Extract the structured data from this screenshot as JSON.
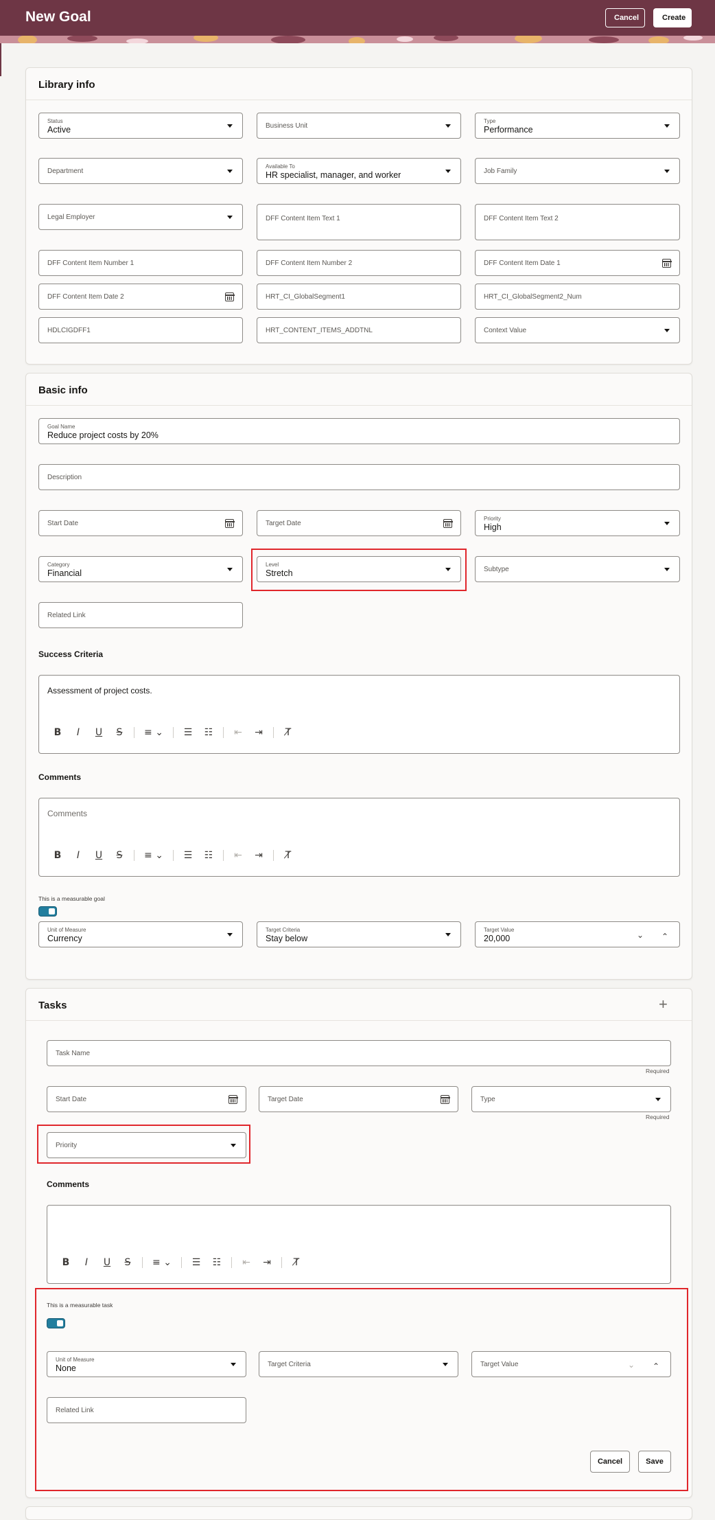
{
  "header": {
    "title": "New Goal",
    "cancel_label": "Cancel",
    "create_label": "Create"
  },
  "library": {
    "title": "Library info",
    "status": {
      "label": "Status",
      "value": "Active"
    },
    "business_unit": {
      "label": "Business Unit"
    },
    "type": {
      "label": "Type",
      "value": "Performance"
    },
    "department": {
      "label": "Department"
    },
    "available_to": {
      "label": "Available To",
      "value": "HR specialist, manager, and worker"
    },
    "job_family": {
      "label": "Job Family"
    },
    "legal_employer": {
      "label": "Legal Employer"
    },
    "dff_text1": {
      "label": "DFF Content Item Text 1"
    },
    "dff_text2": {
      "label": "DFF Content Item Text 2"
    },
    "dff_num1": {
      "label": "DFF Content Item Number 1"
    },
    "dff_num2": {
      "label": "DFF Content Item Number 2"
    },
    "dff_date1": {
      "label": "DFF Content Item Date 1"
    },
    "dff_date2": {
      "label": "DFF Content Item Date 2"
    },
    "global_seg1": {
      "label": "HRT_CI_GlobalSegment1"
    },
    "global_seg2": {
      "label": "HRT_CI_GlobalSegment2_Num"
    },
    "hdl": {
      "label": "HDLCIGDFF1"
    },
    "addtnl": {
      "label": "HRT_CONTENT_ITEMS_ADDTNL"
    },
    "context": {
      "label": "Context Value"
    }
  },
  "basic": {
    "title": "Basic info",
    "goal_name": {
      "label": "Goal Name",
      "value": "Reduce project costs by 20%"
    },
    "description": {
      "label": "Description"
    },
    "start_date": {
      "label": "Start Date"
    },
    "target_date": {
      "label": "Target Date"
    },
    "priority": {
      "label": "Priority",
      "value": "High"
    },
    "category": {
      "label": "Category",
      "value": "Financial"
    },
    "level": {
      "label": "Level",
      "value": "Stretch"
    },
    "subtype": {
      "label": "Subtype"
    },
    "related_link": {
      "label": "Related Link"
    },
    "success_title": "Success Criteria",
    "success_text": "Assessment of project costs.",
    "comments_title": "Comments",
    "comments_placeholder": "Comments",
    "measurable_label": "This is a measurable goal",
    "uom": {
      "label": "Unit of Measure",
      "value": "Currency"
    },
    "target_criteria": {
      "label": "Target Criteria",
      "value": "Stay below"
    },
    "target_value": {
      "label": "Target Value",
      "value": "20,000"
    }
  },
  "tasks": {
    "title": "Tasks",
    "task_name": {
      "label": "Task Name"
    },
    "required": "Required",
    "start_date": {
      "label": "Start Date"
    },
    "target_date": {
      "label": "Target Date"
    },
    "type": {
      "label": "Type"
    },
    "priority": {
      "label": "Priority"
    },
    "comments_title": "Comments",
    "measurable_label": "This is a measurable task",
    "uom": {
      "label": "Unit of Measure",
      "value": "None"
    },
    "target_criteria": {
      "label": "Target Criteria"
    },
    "target_value": {
      "label": "Target Value"
    },
    "related_link": {
      "label": "Related Link"
    },
    "cancel_label": "Cancel",
    "save_label": "Save"
  },
  "toolbar_icons": [
    "bold-icon",
    "italic-icon",
    "underline-icon",
    "strikethrough-icon",
    "align-icon",
    "bullet-list-icon",
    "numbered-list-icon",
    "outdent-icon",
    "indent-icon",
    "clear-format-icon"
  ],
  "colors": {
    "brand": "#6e3645",
    "toggle": "#227e9e",
    "highlight": "#e0262b"
  }
}
